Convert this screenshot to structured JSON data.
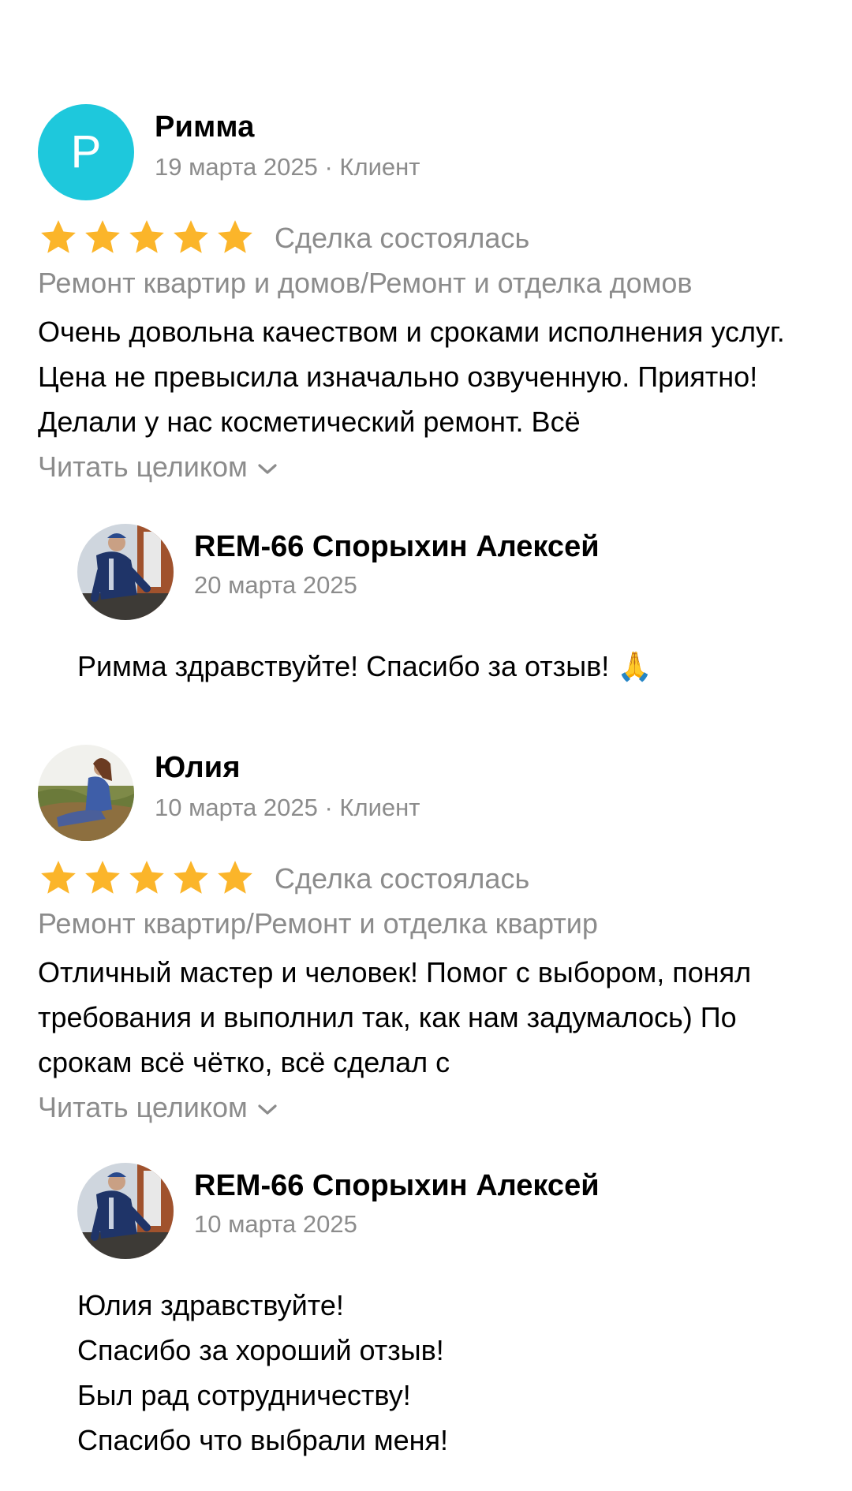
{
  "reviews": [
    {
      "author": "Римма",
      "avatar_letter": "Р",
      "avatar_color": "#1ec8dc",
      "meta": "19 марта 2025 · Клиент",
      "rating": 5,
      "deal_status": "Сделка состоялась",
      "category": "Ремонт квартир и домов/Ремонт и отделка домов",
      "text": "Очень довольна качеством и сроками исполнения услуг. Цена не превысила изначально озвученную. Приятно! Делали у нас косметический ремонт. Всё",
      "read_more": "Читать целиком",
      "reply": {
        "author": "REM-66 Спорыхин Алексей",
        "date": "20 марта 2025",
        "text": "Римма здравствуйте! Спасибо за отзыв! 🙏"
      }
    },
    {
      "author": "Юлия",
      "meta": "10 марта 2025 · Клиент",
      "rating": 5,
      "deal_status": "Сделка состоялась",
      "category": "Ремонт квартир/Ремонт и отделка квартир",
      "text": "Отличный мастер и человек! Помог с выбором, понял требования и выполнил так, как нам задумалось) По срокам всё чётко, всё сделал с",
      "read_more": "Читать целиком",
      "reply": {
        "author": "REM-66 Спорыхин Алексей",
        "date": "10 марта 2025",
        "text": "Юлия здравствуйте!\nСпасибо за хороший отзыв!\nБыл рад сотрудничеству!\nСпасибо что выбрали меня!"
      }
    }
  ],
  "colors": {
    "star": "#fbb52a",
    "muted_text": "#8c8c8c",
    "avatar_accent": "#1ec8dc"
  },
  "icons": {
    "star": "star-icon",
    "chevron": "chevron-down-icon"
  }
}
